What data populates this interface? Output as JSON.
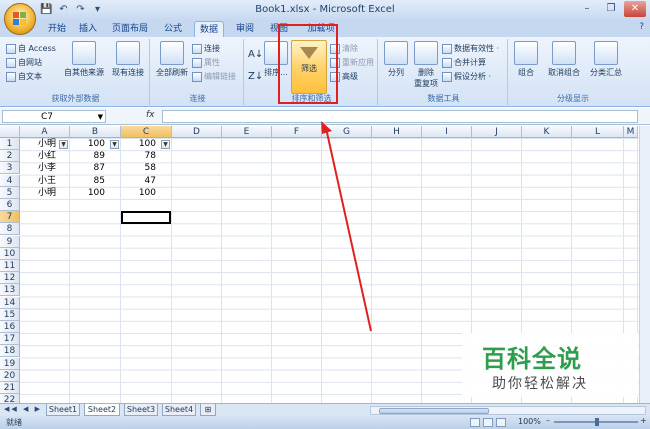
{
  "window": {
    "title": "Book1.xlsx - Microsoft Excel",
    "help": "?",
    "min": "–",
    "max": "❐",
    "close": "✕",
    "qat": [
      "💾",
      "↶",
      "↷",
      "▾"
    ]
  },
  "tabs": [
    "开始",
    "插入",
    "页面布局",
    "公式",
    "数据",
    "审阅",
    "视图",
    "加载项"
  ],
  "active_tab": "数据",
  "ribbon": {
    "get_external": {
      "label": "获取外部数据",
      "access": "自 Access",
      "web": "自网站",
      "text": "自文本",
      "other": "自其他来源",
      "existing": "现有连接"
    },
    "connections": {
      "label": "连接",
      "refresh_all": "全部刷新",
      "connections": "连接",
      "properties": "属性",
      "edit_links": "编辑链接"
    },
    "sort_filter": {
      "label": "排序和筛选",
      "sort": "排序...",
      "filter": "筛选",
      "clear": "清除",
      "reapply": "重新应用",
      "advanced": "高级"
    },
    "data_tools": {
      "label": "数据工具",
      "text_to_columns": "分列",
      "remove_duplicates_1": "删除",
      "remove_duplicates_2": "重复项",
      "validation": "数据有效性 ·",
      "consolidate": "合并计算",
      "whatif": "假设分析 ·"
    },
    "outline": {
      "label": "分级显示",
      "group": "组合",
      "ungroup": "取消组合",
      "subtotal": "分类汇总"
    }
  },
  "formula_bar": {
    "name_box": "C7",
    "fx": "fx",
    "formula": ""
  },
  "columns": [
    "A",
    "B",
    "C",
    "D",
    "E",
    "F",
    "G",
    "H",
    "I",
    "J",
    "K",
    "L",
    "M"
  ],
  "rows": [
    "1",
    "2",
    "3",
    "4",
    "5",
    "6",
    "7",
    "8",
    "9",
    "10",
    "11",
    "12",
    "13",
    "14",
    "15",
    "16",
    "17",
    "18",
    "19",
    "20",
    "21",
    "22"
  ],
  "cells": {
    "A1": "小明",
    "B1": "100",
    "C1": "100",
    "A2": "小红",
    "B2": "89",
    "C2": "78",
    "A3": "小李",
    "B3": "87",
    "C3": "58",
    "A4": "小王",
    "B4": "85",
    "C4": "47",
    "A5": "小明",
    "B5": "100",
    "C5": "100"
  },
  "active_cell": "C7",
  "sheets": [
    "Sheet1",
    "Sheet2",
    "Sheet3",
    "Sheet4"
  ],
  "active_sheet": "Sheet2",
  "status": {
    "ready": "就绪",
    "zoom": "100%",
    "zoom_minus": "–",
    "zoom_plus": "+"
  },
  "watermark": {
    "line1": "百科全说",
    "line2": "助你轻松解决"
  },
  "colors": {
    "annotation_red": "#e02020",
    "watermark_green": "#2e9e4e"
  }
}
